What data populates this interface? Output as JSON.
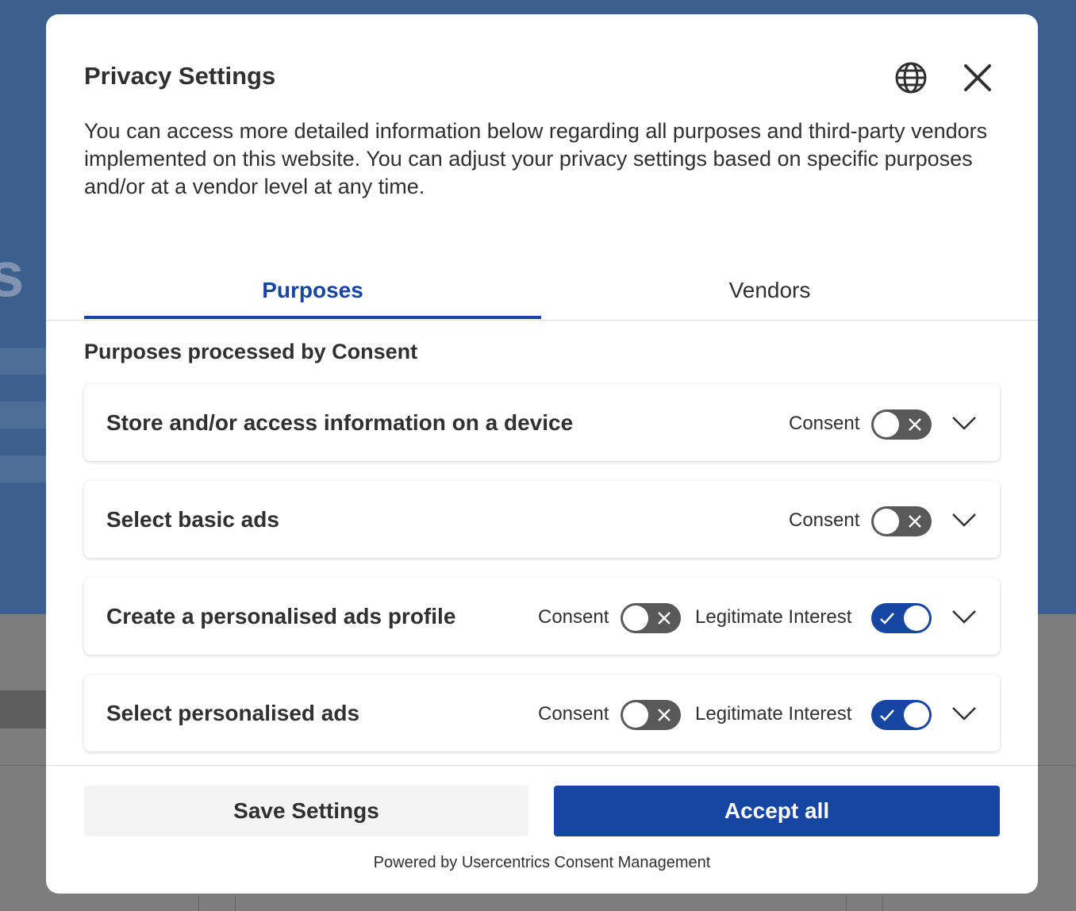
{
  "modal": {
    "title": "Privacy Settings",
    "description": "You can access more detailed information below regarding all purposes and third-party vendors implemented on this website. You can adjust your privacy settings based on specific purposes and/or at a vendor level at any time.",
    "icons": {
      "language": "globe-icon",
      "close": "close-icon"
    }
  },
  "tabs": [
    {
      "label": "Purposes",
      "active": true
    },
    {
      "label": "Vendors",
      "active": false
    }
  ],
  "section_title": "Purposes processed by Consent",
  "purposes": [
    {
      "title": "Store and/or access information on a device",
      "consent_label": "Consent",
      "consent_on": false
    },
    {
      "title": "Select basic ads",
      "consent_label": "Consent",
      "consent_on": false
    },
    {
      "title": "Create a personalised ads profile",
      "consent_label": "Consent",
      "consent_on": false,
      "li_label": "Legitimate Interest",
      "li_on": true
    },
    {
      "title": "Select personalised ads",
      "consent_label": "Consent",
      "consent_on": false,
      "li_label": "Legitimate Interest",
      "li_on": true
    }
  ],
  "footer": {
    "save_label": "Save Settings",
    "accept_label": "Accept all",
    "powered_by": "Powered by Usercentrics Consent Management"
  },
  "colors": {
    "accent": "#1746a2",
    "toggle_off": "#595959",
    "text": "#303030"
  },
  "background": {
    "glyph": "s"
  }
}
